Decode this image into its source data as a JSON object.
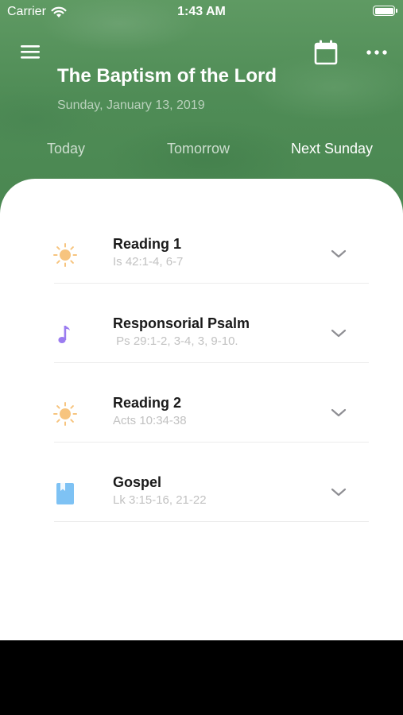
{
  "status_bar": {
    "carrier": "Carrier",
    "time": "1:43 AM"
  },
  "header": {
    "title": "The Baptism of the Lord",
    "date": "Sunday, January 13, 2019",
    "icons": [
      "menu-icon",
      "calendar-icon",
      "more-icon"
    ],
    "tabs": [
      {
        "label": "Today",
        "selected": false
      },
      {
        "label": "Tomorrow",
        "selected": false
      },
      {
        "label": "Next Sunday",
        "selected": true
      }
    ]
  },
  "readings": [
    {
      "title": "Reading 1",
      "reference": "Is 42:1-4, 6-7",
      "icon": "sun-icon",
      "icon_color": "#f7c47e"
    },
    {
      "title": "Responsorial Psalm",
      "reference": " Ps 29:1-2, 3-4, 3, 9-10.",
      "icon": "music-note-icon",
      "icon_color": "#9b7cf0"
    },
    {
      "title": "Reading 2",
      "reference": "Acts 10:34-38",
      "icon": "sun-icon",
      "icon_color": "#f7c47e"
    },
    {
      "title": "Gospel",
      "reference": "Lk 3:15-16, 21-22",
      "icon": "book-icon",
      "icon_color": "#7ec2f4"
    }
  ],
  "colors": {
    "header_green": "#4f8c56",
    "chevron": "#8e8e93"
  }
}
